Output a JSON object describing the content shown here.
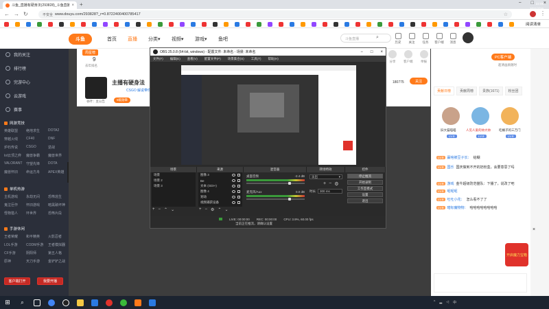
{
  "browser": {
    "tab_title": "斗鱼_直播有硬身法(293828)_斗鱼直播",
    "tab_close": "×",
    "new_tab": "+",
    "window_buttons": [
      "−",
      "□",
      "×"
    ],
    "url_security": "不安全",
    "url": "www.douyu.com/293828?_r=0.8722400400785417",
    "bookmark_folder": "阅读清单"
  },
  "site": {
    "logo_text": "斗鱼",
    "nav": [
      "首页",
      "直播",
      "分类▾",
      "视频▾",
      "游戏▾",
      "鱼吧"
    ],
    "search_placeholder": "斗鱼直播",
    "header_icons": [
      "历史",
      "关注",
      "任务",
      "客户端",
      "消息"
    ]
  },
  "sidebar": {
    "items": [
      "我的关注",
      "排行榜",
      "完游中心",
      "云游戏",
      "赛事"
    ],
    "groups": [
      {
        "title": "网游竞技",
        "games": [
          "英雄联盟",
          "绝地求生",
          "DOTA2",
          "穿越火线",
          "CF40",
          "DNF",
          "炉石传说",
          "CSGO",
          "逆战",
          "lol云顶之弈",
          "魔兽争霸",
          "魔兽世界",
          "VALORANT",
          "守望先锋",
          "DOTA",
          "魔兽怀旧",
          "命运方舟",
          "APEX英雄"
        ]
      },
      {
        "title": "单机热游",
        "games": [
          "主机游戏",
          "永劫无间",
          "恐怖逃生",
          "鬼泣巨作",
          "怀旧游戏",
          "暗黑破坏神",
          "怪物猎人",
          "环世界",
          "恐怖片段"
        ]
      },
      {
        "title": "手游休闲",
        "games": [
          "王者荣耀",
          "和平精英",
          "火影忍者",
          "LOL手游",
          "CODM手游",
          "王者模拟器",
          "CF手游",
          "阴阳师",
          "第五人格",
          "原神",
          "天刀手游",
          "金铲铲之战"
        ]
      }
    ],
    "btn_left": "客户端打开",
    "btn_right": "我要开播"
  },
  "room": {
    "rank_badge": "周星榜",
    "rank_value": "9",
    "rank_sub": "去年排名",
    "title": "主播有硬身法",
    "category": "CSGO 解说带你看",
    "tag": "5级勋章",
    "anchor_name": "谷叶：主公告",
    "hot": "180775",
    "follow_label": "关注",
    "icons": [
      "分享",
      "客户端",
      "举报",
      "更多"
    ]
  },
  "right": {
    "pc_badge": "PC客户端",
    "pc_sub": "超清画质随时",
    "tabs": [
      "贡献日榜",
      "贡献周榜",
      "贵族(1671)",
      "粉丝团"
    ],
    "top_users": [
      {
        "name": "旧大猫喵喵",
        "level": "LV.8"
      },
      {
        "name": "人见人爱的帅大帅",
        "level": "LV.8"
      },
      {
        "name": "吃橘子的三万门",
        "level": "LV.8"
      }
    ],
    "chat": [
      {
        "lv": "LV.8",
        "user": "赢啥被豆子长：",
        "text": "给糊"
      },
      {
        "lv": "LV.8",
        "user": "国乐",
        "text": "国庆做到不开的奶粉盒，会要意思了吗"
      },
      {
        "lv": "LV.8",
        "user": "游戏",
        "text": "金牛超级防范猫队：下播了，说改了吧"
      },
      {
        "lv": "LV.8",
        "user": "呢呢呢",
        "text": ""
      },
      {
        "lv": "LV.8",
        "user": "吐吐小花：",
        "text": "怎么看不了了"
      },
      {
        "lv": "LV.8",
        "user": "暗标魔物物：",
        "text": "哈哈哈哈哈哈哈哈"
      }
    ],
    "gift_label": "开启魔力宝箱",
    "close_label": "×"
  },
  "obs": {
    "title": "OBS 25.0.8 (64-bit, windows) - 配置文件: 未命名 - 场景: 未命名",
    "menu": [
      "文件(F)",
      "编辑(E)",
      "查看(V)",
      "配置文件(P)",
      "场景集合(S)",
      "工具(T)",
      "帮助(H)"
    ],
    "docks": [
      "场景",
      "来源",
      "混音器",
      "转场特效",
      "控件"
    ],
    "scenes": [
      "场景",
      "场景 2",
      "场景 3"
    ],
    "sources": [
      "图像 3",
      "Be",
      "文本 (GDI+)",
      "图像 4",
      "划动",
      "视频捕获设备"
    ],
    "mixer": [
      {
        "name": "桌面音频",
        "db": "-2.4 dB"
      },
      {
        "name": "麦克风/Aux",
        "db": "0.0 dB"
      }
    ],
    "transition": "淡出",
    "duration_label": "时长",
    "duration": "300 ms",
    "controls": [
      "停止推流",
      "开始录制",
      "工作室模式",
      "设置",
      "退出"
    ],
    "status": [
      "LIVE: 00:00:00",
      "REC: 00:00:00",
      "CPU: 3.9%, 60.00 fps"
    ],
    "bottom_note": "当前正在推流，请确认设置"
  },
  "taskbar": {
    "time": "22:08",
    "date": "2021/7/26"
  }
}
